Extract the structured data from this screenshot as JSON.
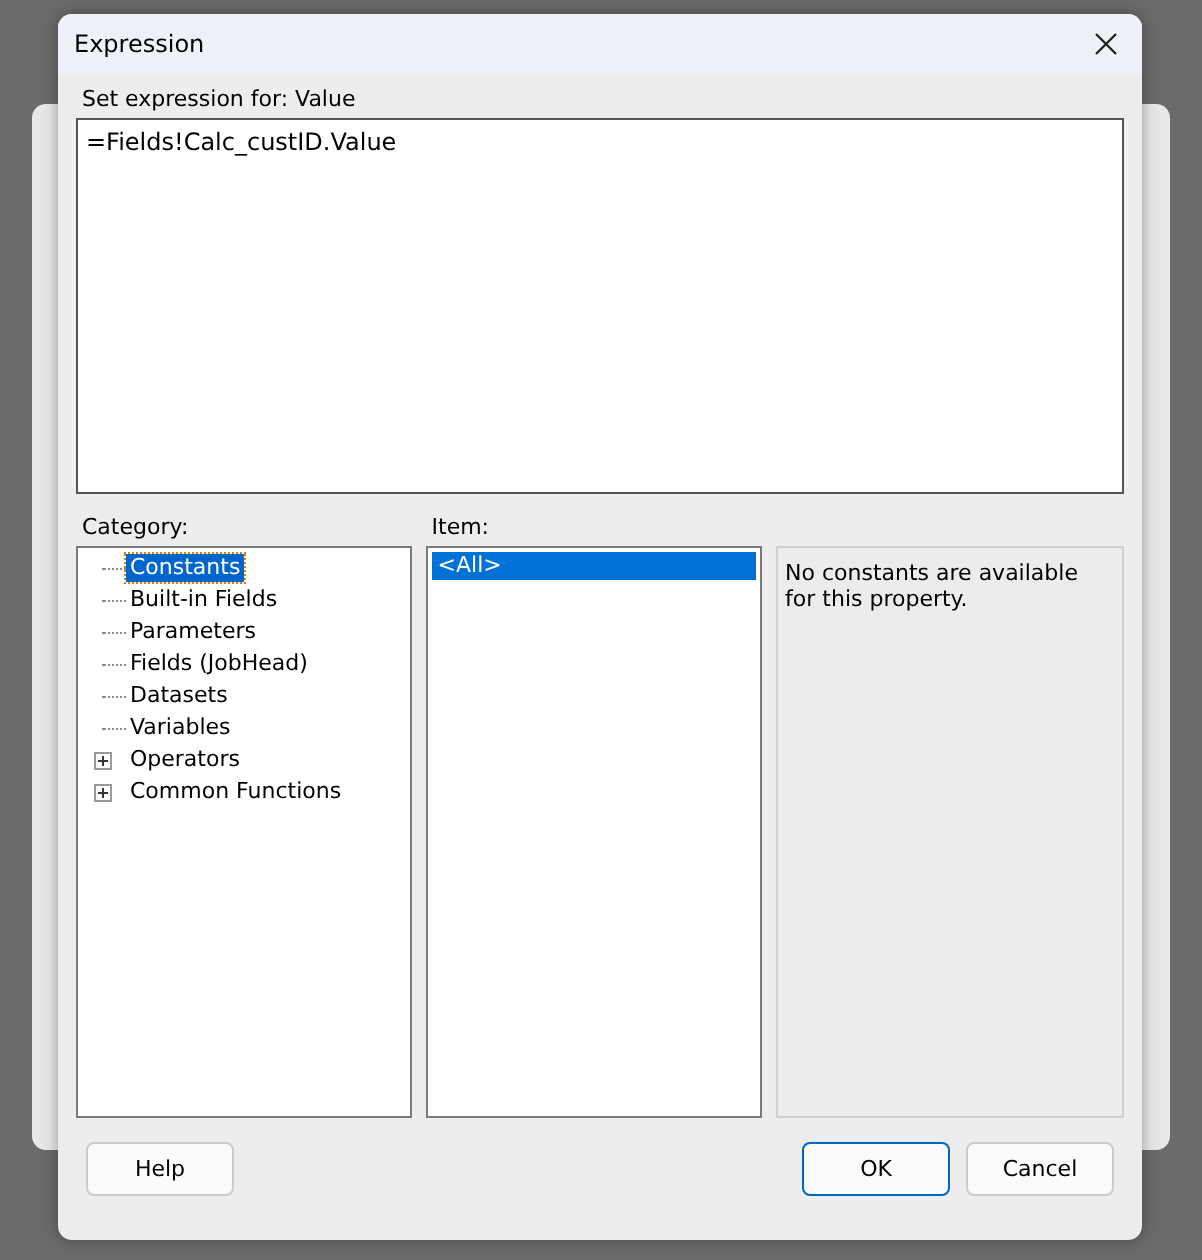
{
  "window": {
    "title": "Expression"
  },
  "expression": {
    "label": "Set expression for: Value",
    "value": "=Fields!Calc_custID.Value"
  },
  "category": {
    "label": "Category:",
    "items": [
      {
        "label": "Constants",
        "selected": true,
        "expandable": false
      },
      {
        "label": "Built-in Fields",
        "selected": false,
        "expandable": false
      },
      {
        "label": "Parameters",
        "selected": false,
        "expandable": false
      },
      {
        "label": "Fields (JobHead)",
        "selected": false,
        "expandable": false
      },
      {
        "label": "Datasets",
        "selected": false,
        "expandable": false
      },
      {
        "label": "Variables",
        "selected": false,
        "expandable": false
      },
      {
        "label": "Operators",
        "selected": false,
        "expandable": true
      },
      {
        "label": "Common Functions",
        "selected": false,
        "expandable": true
      }
    ]
  },
  "item": {
    "label": "Item:",
    "items": [
      {
        "label": "<All>",
        "selected": true
      }
    ]
  },
  "description": "No constants are available for this property.",
  "buttons": {
    "help": "Help",
    "ok": "OK",
    "cancel": "Cancel"
  }
}
